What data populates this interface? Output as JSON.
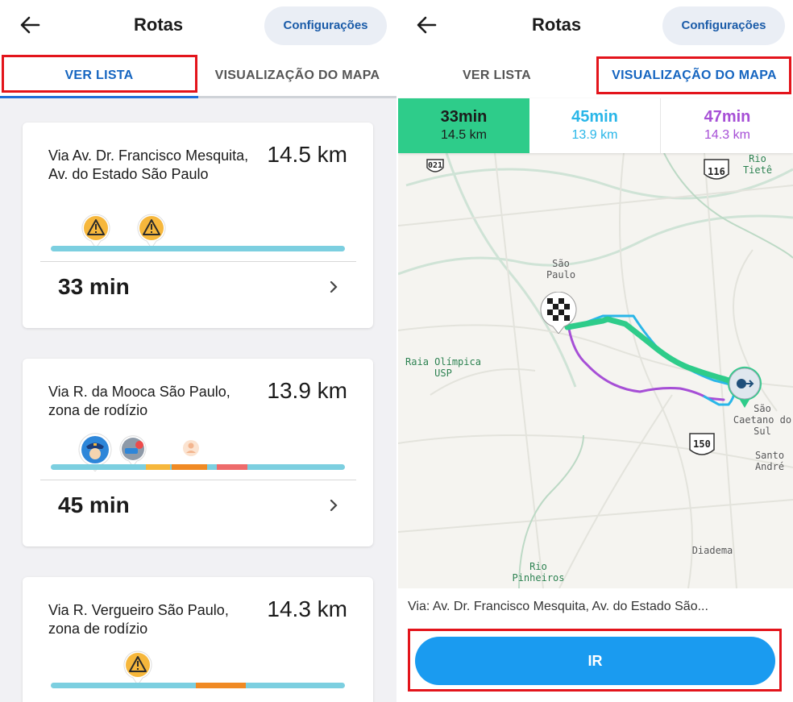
{
  "left": {
    "header": {
      "title": "Rotas",
      "settings_label": "Configurações"
    },
    "tabs": [
      {
        "label": "VER LISTA",
        "active": true
      },
      {
        "label": "VISUALIZAÇÃO DO MAPA",
        "active": false
      }
    ],
    "routes": [
      {
        "via": "Via Av. Dr. Francisco Mesquita, Av. do Estado São Paulo",
        "distance": "14.5 km",
        "time": "33 min",
        "alerts": [
          "hazard-icon",
          "hazard-icon"
        ]
      },
      {
        "via": "Via R. da Mooca São Paulo, zona de rodízio",
        "distance": "13.9 km",
        "time": "45 min",
        "alerts": [
          "police-icon",
          "car-crash-icon",
          "user-report-icon"
        ]
      },
      {
        "via": "Via R. Vergueiro São Paulo, zona de rodízio",
        "distance": "14.3 km",
        "time": "",
        "alerts": [
          "hazard-icon"
        ]
      }
    ]
  },
  "right": {
    "header": {
      "title": "Rotas",
      "settings_label": "Configurações"
    },
    "tabs": [
      {
        "label": "VER LISTA",
        "active": false
      },
      {
        "label": "VISUALIZAÇÃO DO MAPA",
        "active": true
      }
    ],
    "route_options": [
      {
        "time": "33min",
        "distance": "14.5 km",
        "color": "#2ecc8a",
        "selected": true
      },
      {
        "time": "45min",
        "distance": "13.9 km",
        "color": "#29b6e8",
        "selected": false
      },
      {
        "time": "47min",
        "distance": "14.3 km",
        "color": "#a64fd6",
        "selected": false
      }
    ],
    "map_labels": {
      "sao_paulo": "São Paulo",
      "raia": "Raia Olímpica USP",
      "rio_tiete": "Rio Tietê",
      "sao_caetano": "São Caetano do Sul",
      "santo_andre": "Santo André",
      "diadema": "Diadema",
      "rio_pinheiros": "Rio Pinheiros",
      "shield_021": "021",
      "shield_116": "116",
      "shield_150": "150"
    },
    "via_text": "Via: Av. Dr. Francisco Mesquita, Av. do Estado São...",
    "go_label": "IR"
  },
  "colors": {
    "accent_blue": "#1e6fd9",
    "traffic_light": "#7ccfe0",
    "traffic_medium": "#f6b73c",
    "traffic_heavy": "#f08a24",
    "traffic_severe": "#ee6b6b",
    "highlight_red": "#e3141b"
  }
}
